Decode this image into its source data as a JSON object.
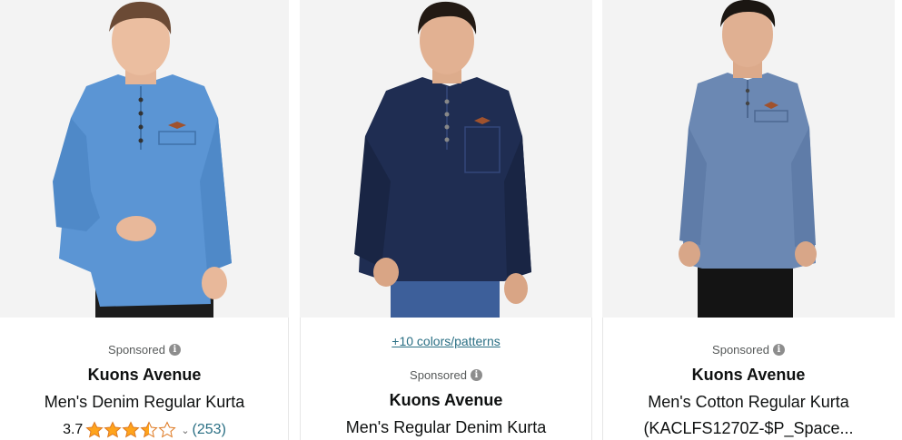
{
  "products": [
    {
      "sponsored": "Sponsored",
      "brand": "Kuons Avenue",
      "title": "Men's Denim Regular Kurta",
      "rating": "3.7",
      "rating_value": 3.5,
      "reviews": "(253)",
      "shirt_color": "#5b95d4"
    },
    {
      "colors_link": "+10 colors/patterns",
      "sponsored": "Sponsored",
      "brand": "Kuons Avenue",
      "title": "Men's Regular Denim Kurta",
      "shirt_color": "#1f2d52"
    },
    {
      "sponsored": "Sponsored",
      "brand": "Kuons Avenue",
      "title_line1": "Men's Cotton Regular Kurta",
      "title_line2": "(KACLFS1270Z-$P_Space...",
      "shirt_color": "#6b88b3"
    }
  ],
  "colors": {
    "link": "#2a6f84",
    "star": "#ffa41c",
    "image_bg": "#f3f3f3"
  }
}
